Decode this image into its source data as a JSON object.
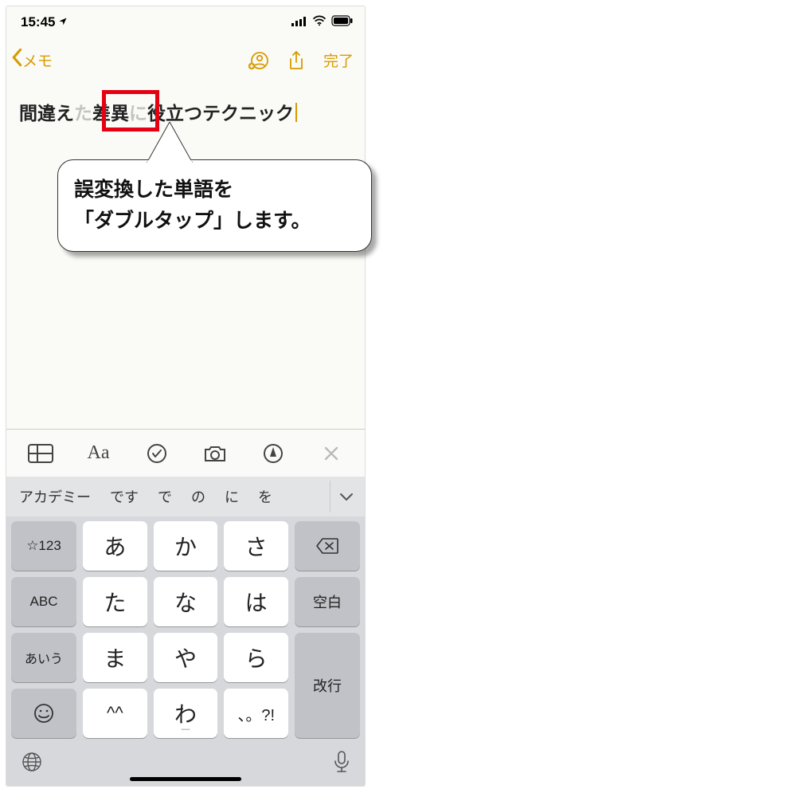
{
  "status": {
    "time": "15:45"
  },
  "nav": {
    "back": "メモ",
    "done": "完了"
  },
  "note": {
    "pre": "間違え",
    "highlighted_left": "",
    "highlighted": "差異",
    "post": "役立つテクニック",
    "raw_visible_prefix": "間違え",
    "raw_visible_mid": "差異",
    "raw_visible_post": "役立つテクニック"
  },
  "callout": {
    "line1": "誤変換した単語を",
    "line2": "「ダブルタップ」します。"
  },
  "candidates": [
    "アカデミー",
    "です",
    "で",
    "の",
    "に",
    "を"
  ],
  "keyboard": {
    "row1": {
      "left": "☆123",
      "k1": "あ",
      "k2": "か",
      "k3": "さ",
      "rightIcon": "delete"
    },
    "row2": {
      "left": "ABC",
      "k1": "た",
      "k2": "な",
      "k3": "は",
      "right": "空白"
    },
    "row3": {
      "left": "あいう",
      "k1": "ま",
      "k2": "や",
      "k3": "ら"
    },
    "row4": {
      "leftIcon": "emoji",
      "k1": "^^",
      "k2": "わ",
      "k3": "、。?!"
    },
    "enter": "改行"
  }
}
